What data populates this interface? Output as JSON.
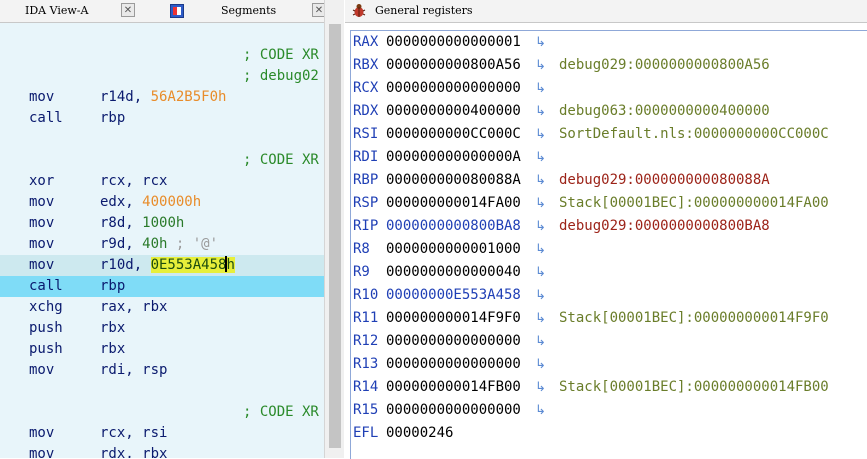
{
  "left_tabs": {
    "ida_view": "IDA View-A",
    "segments": "Segments",
    "close_glyph": "✕"
  },
  "right_title": "General registers",
  "disasm": [
    {
      "comment": "; CODE XR"
    },
    {
      "comment": "; debug02"
    },
    {
      "mnemonic": "mov",
      "op1": "r14d,",
      "op2": "56A2B5F0h",
      "op2_style": "orange"
    },
    {
      "mnemonic": "call",
      "op1": "rbp"
    },
    {},
    {
      "comment": "; CODE XR"
    },
    {
      "mnemonic": "xor",
      "op1": "rcx,",
      "op2": "rcx"
    },
    {
      "mnemonic": "mov",
      "op1": "edx,",
      "op2": "400000h",
      "op2_style": "orange"
    },
    {
      "mnemonic": "mov",
      "op1": "r8d,",
      "op2": "1000h",
      "op2_style": "green"
    },
    {
      "mnemonic": "mov",
      "op1": "r9d,",
      "op2": "40h",
      "op2_style": "green",
      "comment_inline": "; '@'"
    },
    {
      "mnemonic": "mov",
      "op1": "r10d,",
      "op2_pre": "0E553A458",
      "op2_post": "h",
      "op2_style": "yellow",
      "highlight": "gray",
      "caret": true
    },
    {
      "mnemonic": "call",
      "op1": "rbp",
      "highlight": "cyan"
    },
    {
      "mnemonic": "xchg",
      "op1": "rax,",
      "op2": "rbx"
    },
    {
      "mnemonic": "push",
      "op1": "rbx"
    },
    {
      "mnemonic": "push",
      "op1": "rbx"
    },
    {
      "mnemonic": "mov",
      "op1": "rdi,",
      "op2": "rsp"
    },
    {},
    {
      "comment": "; CODE XR"
    },
    {
      "mnemonic": "mov",
      "op1": "rcx,",
      "op2": "rsi"
    },
    {
      "mnemonic": "mov",
      "op1": "rdx,",
      "op2": "rbx"
    }
  ],
  "registers": [
    {
      "name": "RAX",
      "value": "0000000000000001",
      "target": ""
    },
    {
      "name": "RBX",
      "value": "0000000000800A56",
      "target": "debug029:0000000000800A56",
      "target_kind": "stack"
    },
    {
      "name": "RCX",
      "value": "0000000000000000",
      "target": ""
    },
    {
      "name": "RDX",
      "value": "0000000000400000",
      "target": "debug063:0000000000400000",
      "target_kind": "stack"
    },
    {
      "name": "RSI",
      "value": "0000000000CC000C",
      "target": "SortDefault.nls:0000000000CC000C",
      "target_kind": "stack"
    },
    {
      "name": "RDI",
      "value": "000000000000000A",
      "target": ""
    },
    {
      "name": "RBP",
      "value": "000000000080088A",
      "target": "debug029:000000000080088A",
      "target_kind": "code"
    },
    {
      "name": "RSP",
      "value": "000000000014FA00",
      "target": "Stack[00001BEC]:000000000014FA00",
      "target_kind": "stack"
    },
    {
      "name": "RIP",
      "value": "0000000000800BA8",
      "target": "debug029:0000000000800BA8",
      "target_kind": "code",
      "value_color": "blue"
    },
    {
      "name": "R8",
      "value": "0000000000001000",
      "target": ""
    },
    {
      "name": "R9",
      "value": "0000000000000040",
      "target": ""
    },
    {
      "name": "R10",
      "value": "00000000E553A458",
      "target": "",
      "value_color": "blue"
    },
    {
      "name": "R11",
      "value": "000000000014F9F0",
      "target": "Stack[00001BEC]:000000000014F9F0",
      "target_kind": "stack"
    },
    {
      "name": "R12",
      "value": "0000000000000000",
      "target": ""
    },
    {
      "name": "R13",
      "value": "0000000000000000",
      "target": ""
    },
    {
      "name": "R14",
      "value": "000000000014FB00",
      "target": "Stack[00001BEC]:000000000014FB00",
      "target_kind": "stack"
    },
    {
      "name": "R15",
      "value": "0000000000000000",
      "target": ""
    },
    {
      "name": "EFL",
      "value": "00000246",
      "target": "",
      "no_arrow": true
    }
  ],
  "arrow_glyph": "↳"
}
